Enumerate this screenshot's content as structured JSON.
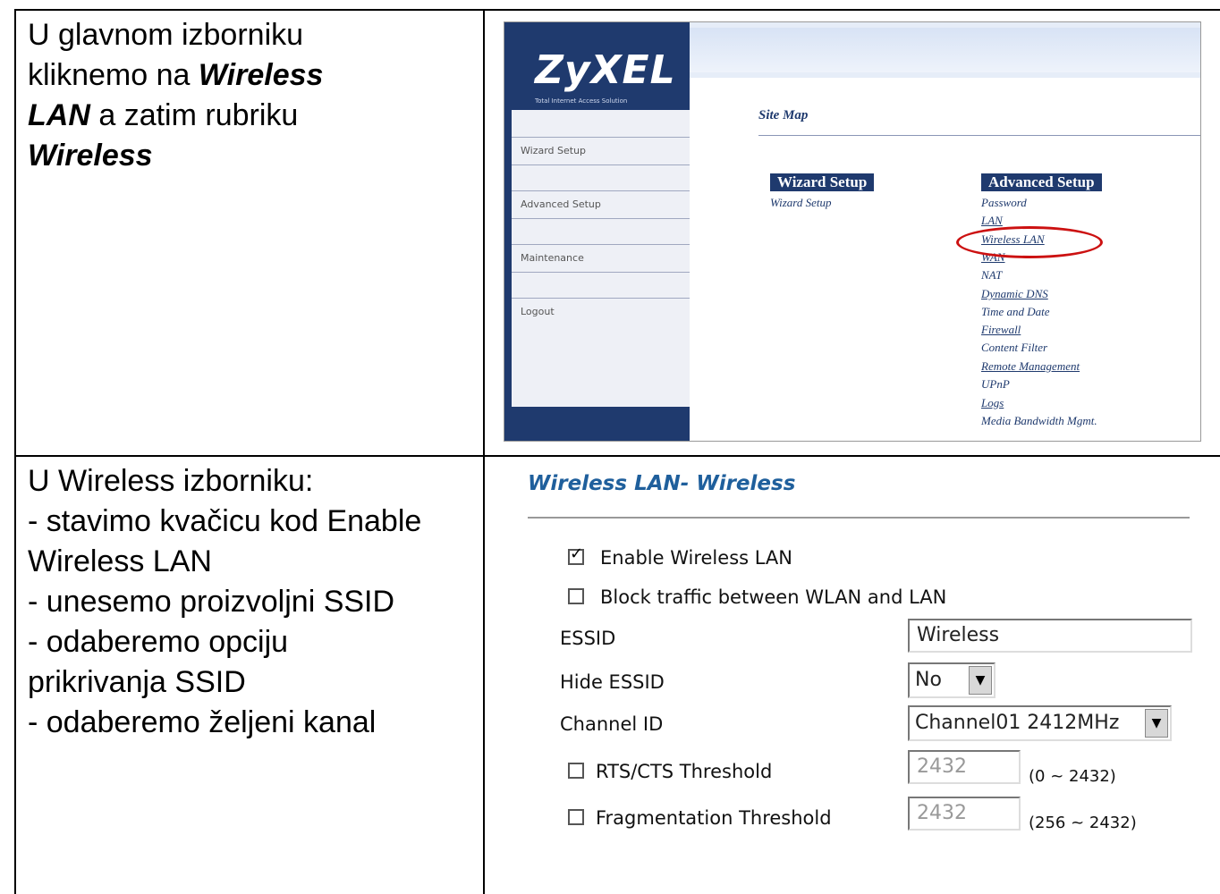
{
  "row1": {
    "left_lines": [
      "U glavnom izborniku",
      "kliknemo na ",
      "Wireless",
      "LAN",
      " a zatim rubriku",
      "Wireless"
    ],
    "zyxel": {
      "logo": "ZyXEL",
      "tagline": "Total Internet Access Solution",
      "menu": [
        "Wizard Setup",
        "Advanced Setup",
        "Maintenance",
        "Logout"
      ],
      "title": "Site Map",
      "wizard_header": "Wizard Setup",
      "wizard_links": [
        "Wizard Setup"
      ],
      "advanced_header": "Advanced Setup",
      "advanced_links": [
        "Password",
        "LAN",
        "Wireless LAN",
        "WAN",
        "NAT",
        "Dynamic DNS",
        "Time and Date",
        "Firewall",
        "Content Filter",
        "Remote Management",
        "UPnP",
        "Logs",
        "Media Bandwidth Mgmt."
      ]
    }
  },
  "row2": {
    "left_lines": [
      "U Wireless izborniku:",
      "- stavimo kvačicu kod Enable",
      "Wireless LAN",
      "- unesemo proizvoljni SSID",
      "- odaberemo opciju",
      "prikrivanja SSID",
      "- odaberemo željeni kanal"
    ],
    "form": {
      "title": "Wireless LAN- Wireless",
      "enable_label": "Enable Wireless LAN",
      "enable_checked": true,
      "block_label": "Block traffic between WLAN and LAN",
      "block_checked": false,
      "essid_label": "ESSID",
      "essid_value": "Wireless",
      "hide_label": "Hide ESSID",
      "hide_value": "No",
      "channel_label": "Channel ID",
      "channel_value": "Channel01 2412MHz",
      "rts_label": "RTS/CTS Threshold",
      "rts_value": "2432",
      "rts_range": "(0 ~ 2432)",
      "frag_label": "Fragmentation Threshold",
      "frag_value": "2432",
      "frag_range": "(256 ~ 2432)"
    }
  },
  "icons": {
    "checkbox_checked": "✓",
    "dropdown_arrow": "▼"
  }
}
